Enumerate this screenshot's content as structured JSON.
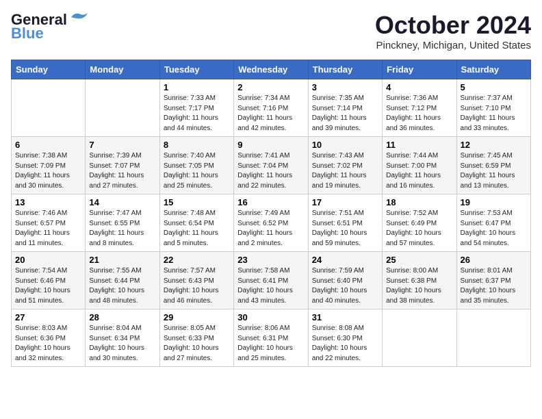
{
  "header": {
    "logo_line1": "General",
    "logo_line2": "Blue",
    "month": "October 2024",
    "location": "Pinckney, Michigan, United States"
  },
  "weekdays": [
    "Sunday",
    "Monday",
    "Tuesday",
    "Wednesday",
    "Thursday",
    "Friday",
    "Saturday"
  ],
  "weeks": [
    [
      {
        "day": "",
        "info": ""
      },
      {
        "day": "",
        "info": ""
      },
      {
        "day": "1",
        "info": "Sunrise: 7:33 AM\nSunset: 7:17 PM\nDaylight: 11 hours and 44 minutes."
      },
      {
        "day": "2",
        "info": "Sunrise: 7:34 AM\nSunset: 7:16 PM\nDaylight: 11 hours and 42 minutes."
      },
      {
        "day": "3",
        "info": "Sunrise: 7:35 AM\nSunset: 7:14 PM\nDaylight: 11 hours and 39 minutes."
      },
      {
        "day": "4",
        "info": "Sunrise: 7:36 AM\nSunset: 7:12 PM\nDaylight: 11 hours and 36 minutes."
      },
      {
        "day": "5",
        "info": "Sunrise: 7:37 AM\nSunset: 7:10 PM\nDaylight: 11 hours and 33 minutes."
      }
    ],
    [
      {
        "day": "6",
        "info": "Sunrise: 7:38 AM\nSunset: 7:09 PM\nDaylight: 11 hours and 30 minutes."
      },
      {
        "day": "7",
        "info": "Sunrise: 7:39 AM\nSunset: 7:07 PM\nDaylight: 11 hours and 27 minutes."
      },
      {
        "day": "8",
        "info": "Sunrise: 7:40 AM\nSunset: 7:05 PM\nDaylight: 11 hours and 25 minutes."
      },
      {
        "day": "9",
        "info": "Sunrise: 7:41 AM\nSunset: 7:04 PM\nDaylight: 11 hours and 22 minutes."
      },
      {
        "day": "10",
        "info": "Sunrise: 7:43 AM\nSunset: 7:02 PM\nDaylight: 11 hours and 19 minutes."
      },
      {
        "day": "11",
        "info": "Sunrise: 7:44 AM\nSunset: 7:00 PM\nDaylight: 11 hours and 16 minutes."
      },
      {
        "day": "12",
        "info": "Sunrise: 7:45 AM\nSunset: 6:59 PM\nDaylight: 11 hours and 13 minutes."
      }
    ],
    [
      {
        "day": "13",
        "info": "Sunrise: 7:46 AM\nSunset: 6:57 PM\nDaylight: 11 hours and 11 minutes."
      },
      {
        "day": "14",
        "info": "Sunrise: 7:47 AM\nSunset: 6:55 PM\nDaylight: 11 hours and 8 minutes."
      },
      {
        "day": "15",
        "info": "Sunrise: 7:48 AM\nSunset: 6:54 PM\nDaylight: 11 hours and 5 minutes."
      },
      {
        "day": "16",
        "info": "Sunrise: 7:49 AM\nSunset: 6:52 PM\nDaylight: 11 hours and 2 minutes."
      },
      {
        "day": "17",
        "info": "Sunrise: 7:51 AM\nSunset: 6:51 PM\nDaylight: 10 hours and 59 minutes."
      },
      {
        "day": "18",
        "info": "Sunrise: 7:52 AM\nSunset: 6:49 PM\nDaylight: 10 hours and 57 minutes."
      },
      {
        "day": "19",
        "info": "Sunrise: 7:53 AM\nSunset: 6:47 PM\nDaylight: 10 hours and 54 minutes."
      }
    ],
    [
      {
        "day": "20",
        "info": "Sunrise: 7:54 AM\nSunset: 6:46 PM\nDaylight: 10 hours and 51 minutes."
      },
      {
        "day": "21",
        "info": "Sunrise: 7:55 AM\nSunset: 6:44 PM\nDaylight: 10 hours and 48 minutes."
      },
      {
        "day": "22",
        "info": "Sunrise: 7:57 AM\nSunset: 6:43 PM\nDaylight: 10 hours and 46 minutes."
      },
      {
        "day": "23",
        "info": "Sunrise: 7:58 AM\nSunset: 6:41 PM\nDaylight: 10 hours and 43 minutes."
      },
      {
        "day": "24",
        "info": "Sunrise: 7:59 AM\nSunset: 6:40 PM\nDaylight: 10 hours and 40 minutes."
      },
      {
        "day": "25",
        "info": "Sunrise: 8:00 AM\nSunset: 6:38 PM\nDaylight: 10 hours and 38 minutes."
      },
      {
        "day": "26",
        "info": "Sunrise: 8:01 AM\nSunset: 6:37 PM\nDaylight: 10 hours and 35 minutes."
      }
    ],
    [
      {
        "day": "27",
        "info": "Sunrise: 8:03 AM\nSunset: 6:36 PM\nDaylight: 10 hours and 32 minutes."
      },
      {
        "day": "28",
        "info": "Sunrise: 8:04 AM\nSunset: 6:34 PM\nDaylight: 10 hours and 30 minutes."
      },
      {
        "day": "29",
        "info": "Sunrise: 8:05 AM\nSunset: 6:33 PM\nDaylight: 10 hours and 27 minutes."
      },
      {
        "day": "30",
        "info": "Sunrise: 8:06 AM\nSunset: 6:31 PM\nDaylight: 10 hours and 25 minutes."
      },
      {
        "day": "31",
        "info": "Sunrise: 8:08 AM\nSunset: 6:30 PM\nDaylight: 10 hours and 22 minutes."
      },
      {
        "day": "",
        "info": ""
      },
      {
        "day": "",
        "info": ""
      }
    ]
  ]
}
